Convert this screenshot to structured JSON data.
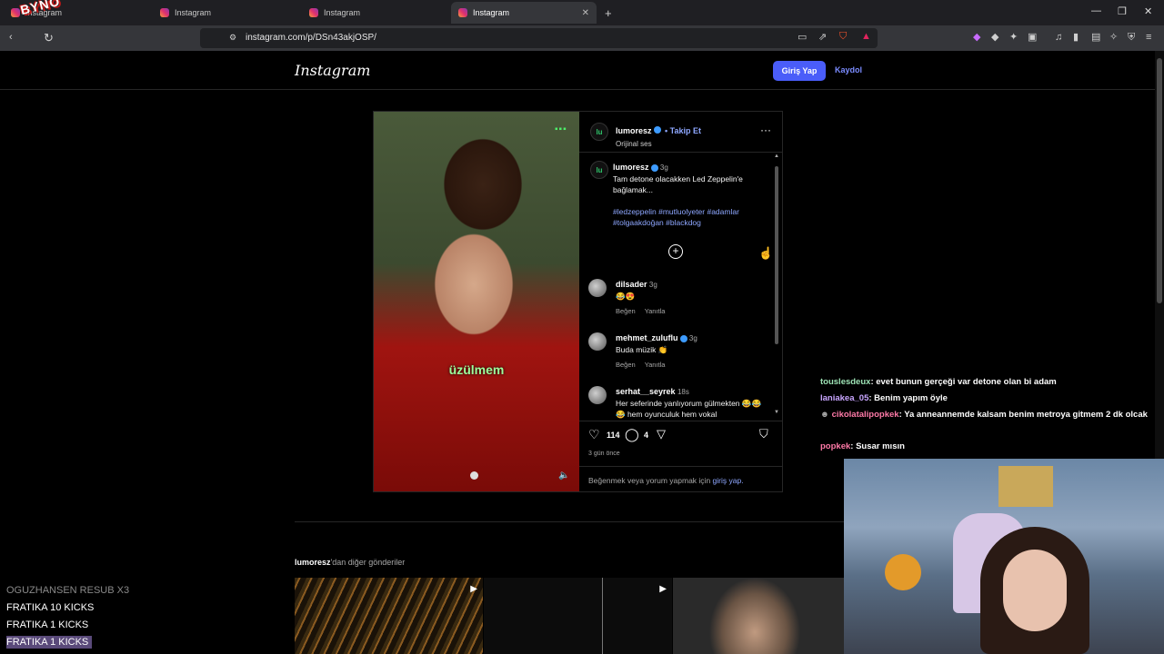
{
  "browser": {
    "tabs": [
      {
        "label": "Instagram",
        "active": false
      },
      {
        "label": "Instagram",
        "active": false
      },
      {
        "label": "Instagram",
        "active": false
      },
      {
        "label": "Instagram",
        "active": true
      }
    ],
    "url": "instagram.com/p/DSn43akjOSP/"
  },
  "instagram": {
    "logo": "Instagram",
    "login_label": "Giriş Yap",
    "signup_label": "Kaydol",
    "accent": "#4a5df9"
  },
  "post": {
    "video_caption": "üzülmem",
    "author": "lumoresz",
    "avatar_text": "lu",
    "follow_label": "• Takip Et",
    "audio": "Orijinal ses",
    "caption_author": "lumoresz",
    "caption_age": "3g",
    "caption_text": "Tam detone olacakken Led Zeppelin'e bağlamak...",
    "hashtags_line1": "#ledzeppelin #mutluolyeter #adamlar",
    "hashtags_line2": "#tolgaakdoğan #blackdog",
    "comments": [
      {
        "user": "dilsader",
        "age": "3g",
        "text": "😂😍",
        "like": "Beğen",
        "reply": "Yanıtla"
      },
      {
        "user": "mehmet_zuluflu",
        "age": "3g",
        "text": "Buda müzik 👏",
        "like": "Beğen",
        "reply": "Yanıtla"
      },
      {
        "user": "serhat__seyrek",
        "age": "18s",
        "text": "Her seferinde yanlıyorum gülmekten 😂😂😂 hem oyunculuk hem vokal"
      }
    ],
    "likes": "114",
    "comment_count": "4",
    "time_ago": "3 gün önce",
    "login_prompt": "Beğenmek veya yorum yapmak için",
    "login_prompt_link": "giriş yap."
  },
  "more_posts": {
    "user": "lumoresz",
    "suffix": "'dan diğer gönderiler"
  },
  "stream": {
    "chat": [
      {
        "user": "touslesdeux",
        "color": "#9de3b5",
        "text": ": evet bunun gerçeği var detone olan bi adam"
      },
      {
        "user": "laniakea_05",
        "color": "#c9a6ff",
        "text": ": Benim yapım öyle"
      },
      {
        "user": "cikolatalipopkek",
        "color": "#ff7aa8",
        "text": ": Ya anneannemde kalsam benim metroya gitmem 2 dk olcak"
      },
      {
        "user": "popkek",
        "color": "#ff7aa8",
        "text": ": Susar mısın"
      }
    ],
    "kicks": [
      {
        "text": "OGUZHANSEN  RESUB X3"
      },
      {
        "text": "FRATIKA  10 KICKS"
      },
      {
        "text": "FRATIKA  1 KICKS"
      },
      {
        "text": "FRATIKA  1 KICKS"
      }
    ]
  }
}
